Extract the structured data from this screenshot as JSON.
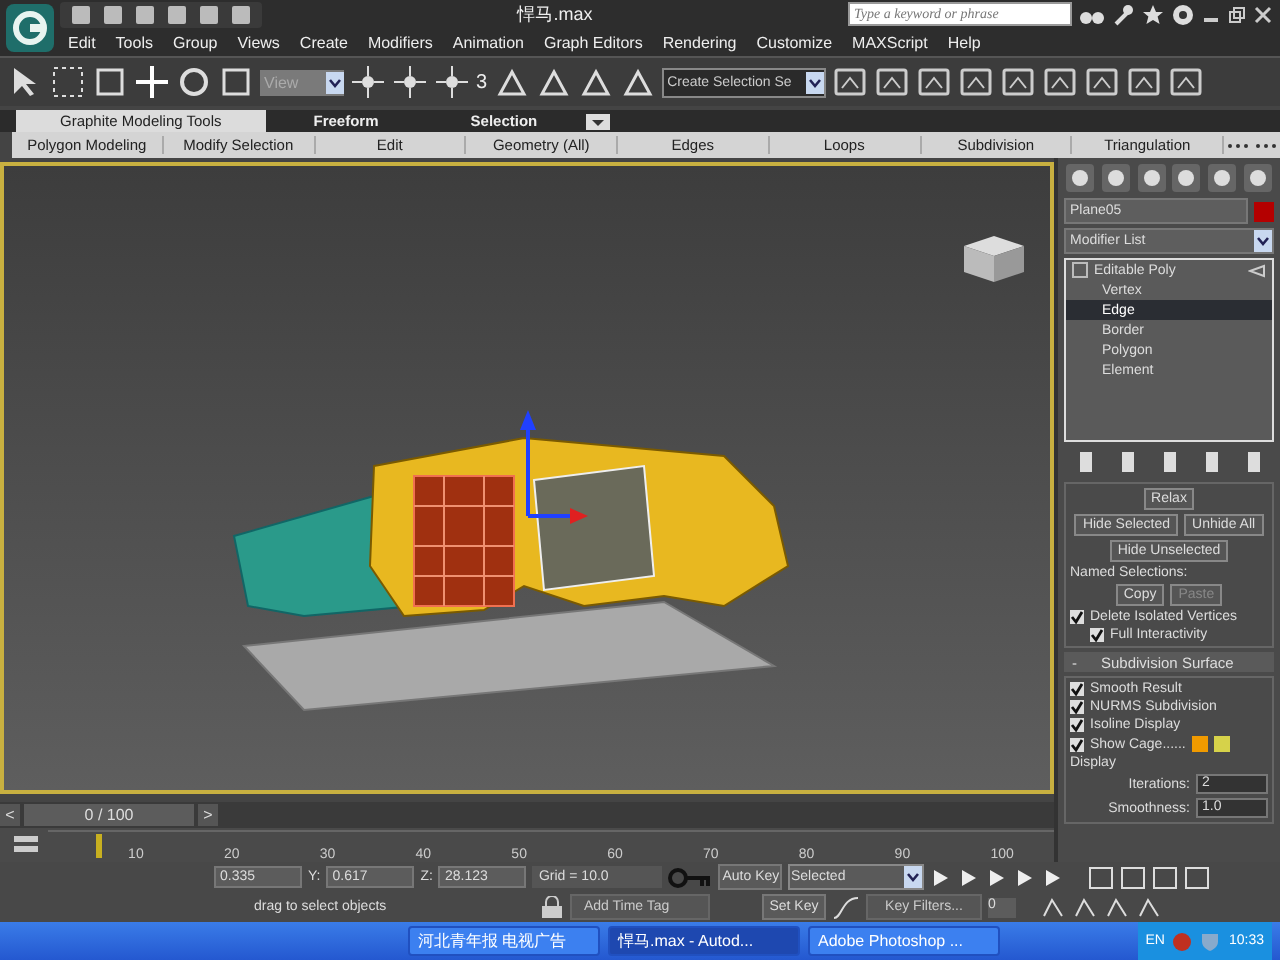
{
  "window": {
    "title": "悍马.max"
  },
  "search": {
    "placeholder": "Type a keyword or phrase"
  },
  "menu": [
    "Edit",
    "Tools",
    "Group",
    "Views",
    "Create",
    "Modifiers",
    "Animation",
    "Graph Editors",
    "Rendering",
    "Customize",
    "MAXScript",
    "Help"
  ],
  "toolbar": {
    "view_dropdown": "View",
    "selection_set": "Create Selection Se",
    "snap_label": "3"
  },
  "ribbon": {
    "tabs": [
      {
        "label": "Graphite Modeling Tools",
        "selected": true
      },
      {
        "label": "Freeform",
        "selected": false
      },
      {
        "label": "Selection",
        "selected": false
      }
    ],
    "panels": [
      "Polygon Modeling",
      "Modify Selection",
      "Edit",
      "Geometry (All)",
      "Edges",
      "Loops",
      "Subdivision",
      "Triangulation"
    ]
  },
  "command_panel": {
    "object_name": "Plane05",
    "modifier_list": "Modifier List",
    "stack": [
      {
        "label": "Editable Poly",
        "expanded": true,
        "children": [
          {
            "label": "Vertex",
            "selected": false
          },
          {
            "label": "Edge",
            "selected": true
          },
          {
            "label": "Border",
            "selected": false
          },
          {
            "label": "Polygon",
            "selected": false
          },
          {
            "label": "Element",
            "selected": false
          }
        ]
      }
    ],
    "relax": "Relax",
    "hide_selected": "Hide Selected",
    "unhide_all": "Unhide All",
    "hide_unselected": "Hide Unselected",
    "named_selections": "Named Selections:",
    "copy": "Copy",
    "paste": {
      "label": "Paste",
      "disabled": true
    },
    "checks": [
      {
        "label": "Delete Isolated Vertices",
        "checked": true
      },
      {
        "label": "Full Interactivity",
        "checked": true
      }
    ],
    "subdivision": {
      "sign": "-",
      "title": "Subdivision Surface",
      "checks": [
        {
          "label": "Smooth Result",
          "checked": true
        },
        {
          "label": "NURMS Subdivision",
          "checked": true
        },
        {
          "label": "Isoline Display",
          "checked": true
        },
        {
          "label": "Show Cage......",
          "checked": true
        }
      ],
      "cage_swatches": [
        {
          "color": "#f09a00"
        },
        {
          "color": "#d6d24a"
        }
      ],
      "display_label": "Display",
      "iterations": {
        "label": "Iterations:",
        "value": "2"
      },
      "smoothness": {
        "label": "Smoothness:",
        "value": "1.0"
      }
    }
  },
  "timeline": {
    "prev": "<",
    "frame": "0 / 100",
    "next": ">",
    "ticks": [
      "10",
      "20",
      "30",
      "40",
      "50",
      "60",
      "70",
      "80",
      "90",
      "100"
    ]
  },
  "status": {
    "coords": [
      {
        "value": "0.335"
      },
      {
        "label": "Y:",
        "value": "0.617"
      },
      {
        "label": "Z:",
        "value": "28.123"
      }
    ],
    "grid": "Grid = 10.0",
    "prompt": "drag to select objects",
    "add_time_tag": "Add Time Tag",
    "auto_key": "Auto Key",
    "set_key": "Set Key",
    "key_mode": "Selected",
    "key_filters": "Key Filters...",
    "frame_field": "0"
  },
  "taskbar": {
    "items": [
      {
        "label": "河北青年报 电视广告",
        "selected": false
      },
      {
        "label": "悍马.max - Autod...",
        "selected": true
      },
      {
        "label": "Adobe Photoshop ...",
        "selected": false
      }
    ],
    "lang": "EN",
    "time": "10:33"
  }
}
